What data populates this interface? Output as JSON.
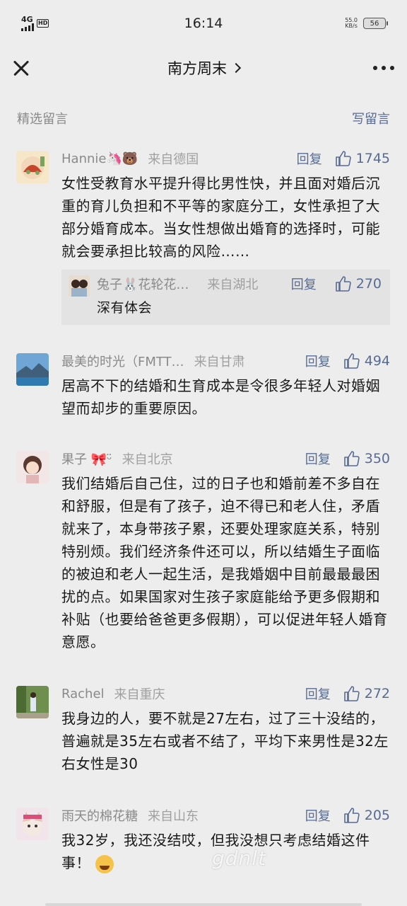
{
  "status_bar": {
    "network": "4G",
    "hd": "HD",
    "time": "16:14",
    "speed_value": "55.0",
    "speed_unit": "KB/s",
    "battery": "56"
  },
  "nav": {
    "title": "南方周末"
  },
  "section": {
    "title": "精选留言",
    "write_label": "写留言"
  },
  "comments": [
    {
      "name": "Hannie🦄🐻",
      "location": "来自德国",
      "reply_label": "回复",
      "likes": "1745",
      "text": "女性受教育水平提升得比男性快，并且面对婚后沉重的育儿负担和不平等的家庭分工，女性承担了大部分婚育成本。当女性想做出婚育的选择时，可能就会要承担比较高的风险……",
      "reply": {
        "name": "兔子🐰花轮花…",
        "location": "来自湖北",
        "reply_label": "回复",
        "likes": "270",
        "text": "深有体会"
      }
    },
    {
      "name": "最美的时光（FMTT…",
      "location": "来自甘肃",
      "reply_label": "回复",
      "likes": "494",
      "text": "居高不下的结婚和生育成本是令很多年轻人对婚姻望而却步的重要原因。"
    },
    {
      "name": "果子 🎀ᵕ̈",
      "location": "来自北京",
      "reply_label": "回复",
      "likes": "350",
      "text": "我们结婚后自己住，过的日子也和婚前差不多自在和舒服，但是有了孩子，迫不得已和老人住，矛盾就来了，本身带孩子累，还要处理家庭关系，特别特别烦。我们经济条件还可以，所以结婚生子面临的被迫和老人一起生活，是我婚姻中目前最最最困扰的点。如果国家对生孩子家庭能给予更多假期和补贴（也要给爸爸更多假期），可以促进年轻人婚育意愿。"
    },
    {
      "name": "Rachel",
      "location": "来自重庆",
      "reply_label": "回复",
      "likes": "272",
      "text": "我身边的人，要不就是27左右，过了三十没结的，普遍就是35左右或者不结了，平均下来男性是32左右女性是30"
    },
    {
      "name": "雨天的棉花糖",
      "location": "来自山东",
      "reply_label": "回复",
      "likes": "205",
      "text": "我32岁，我还没结哎，但我没想只考虑结婚这件事！"
    }
  ],
  "watermark": "gdnlt"
}
